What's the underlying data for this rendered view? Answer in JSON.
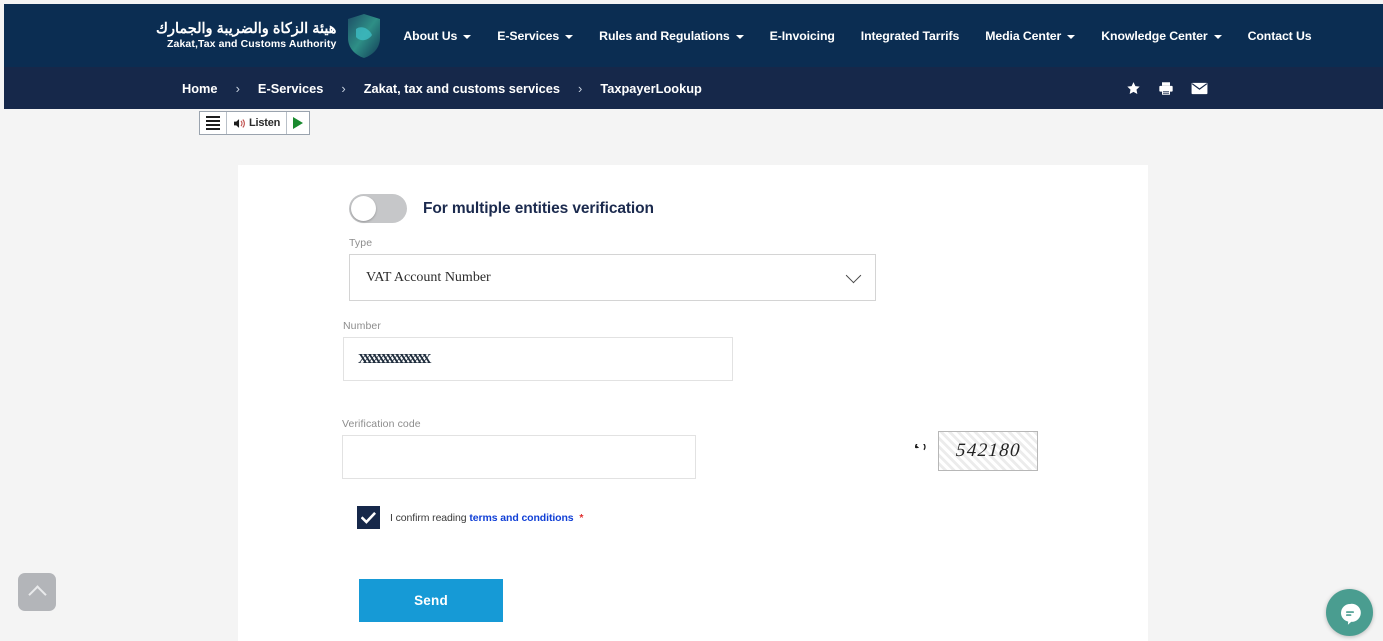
{
  "header": {
    "brand_ar": "هيئة الزكاة والضريبة والجمارك",
    "brand_en": "Zakat,Tax and Customs Authority",
    "logo_name": "zatca-shield-logo",
    "menu": [
      {
        "label": "About Us",
        "has_caret": true
      },
      {
        "label": "E-Services",
        "has_caret": true
      },
      {
        "label": "Rules and Regulations",
        "has_caret": true
      },
      {
        "label": "E-Invoicing",
        "has_caret": false
      },
      {
        "label": "Integrated Tarrifs",
        "has_caret": false
      },
      {
        "label": "Media Center",
        "has_caret": true
      },
      {
        "label": "Knowledge Center",
        "has_caret": true
      },
      {
        "label": "Contact Us",
        "has_caret": false
      }
    ]
  },
  "breadcrumb": {
    "separator": "›",
    "items": [
      {
        "label": "Home"
      },
      {
        "label": "E-Services"
      },
      {
        "label": "Zakat, tax and customs services"
      },
      {
        "label": "TaxpayerLookup"
      }
    ],
    "actions": [
      {
        "icon": "star-icon"
      },
      {
        "icon": "print-icon"
      },
      {
        "icon": "email-icon"
      }
    ]
  },
  "listen_widget": {
    "menu_icon": "lines-icon",
    "label": "Listen",
    "speaker_icon": "speaker-icon",
    "play_icon": "play-icon"
  },
  "form": {
    "toggle": {
      "label": "For multiple entities verification",
      "state": "off"
    },
    "type": {
      "label": "Type",
      "value": "VAT Account Number",
      "chevron_icon": "chevron-down-icon",
      "options": [
        "VAT Account Number"
      ]
    },
    "number": {
      "label": "Number",
      "value": "XXXXXXXXXXXXXXX",
      "placeholder": ""
    },
    "verification_code": {
      "label": "Verification code",
      "value": "",
      "placeholder": ""
    },
    "captcha": {
      "refresh_icon": "refresh-icon",
      "text": "542180"
    },
    "confirm": {
      "checked": true,
      "text_before": "I confirm reading",
      "link_text": "terms and conditions",
      "required_mark": "*"
    },
    "submit": {
      "label": "Send"
    }
  },
  "floating": {
    "scroll_top": {
      "icon": "chevron-up-icon"
    },
    "chat": {
      "icon": "chat-bubble-icon"
    }
  },
  "colors": {
    "header_navy": "#0b2d52",
    "breadcrumb_navy": "#16284a",
    "accent_blue": "#169ad6",
    "link_blue": "#1140d6",
    "chat_teal": "#4a9d90",
    "required_red": "#e03131"
  }
}
